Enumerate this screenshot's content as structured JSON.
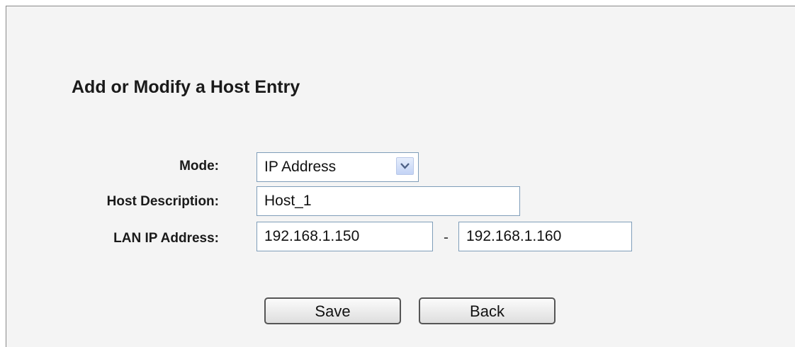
{
  "form": {
    "title": "Add or Modify a Host Entry",
    "mode_label": "Mode:",
    "mode_value": "IP Address",
    "host_description_label": "Host Description:",
    "host_description_value": "Host_1",
    "lan_ip_label": "LAN IP Address:",
    "lan_ip_start": "192.168.1.150",
    "range_separator": "-",
    "lan_ip_end": "192.168.1.160"
  },
  "buttons": {
    "save_label": "Save",
    "back_label": "Back"
  },
  "icons": {
    "select_arrow": "chevron-down-icon"
  }
}
